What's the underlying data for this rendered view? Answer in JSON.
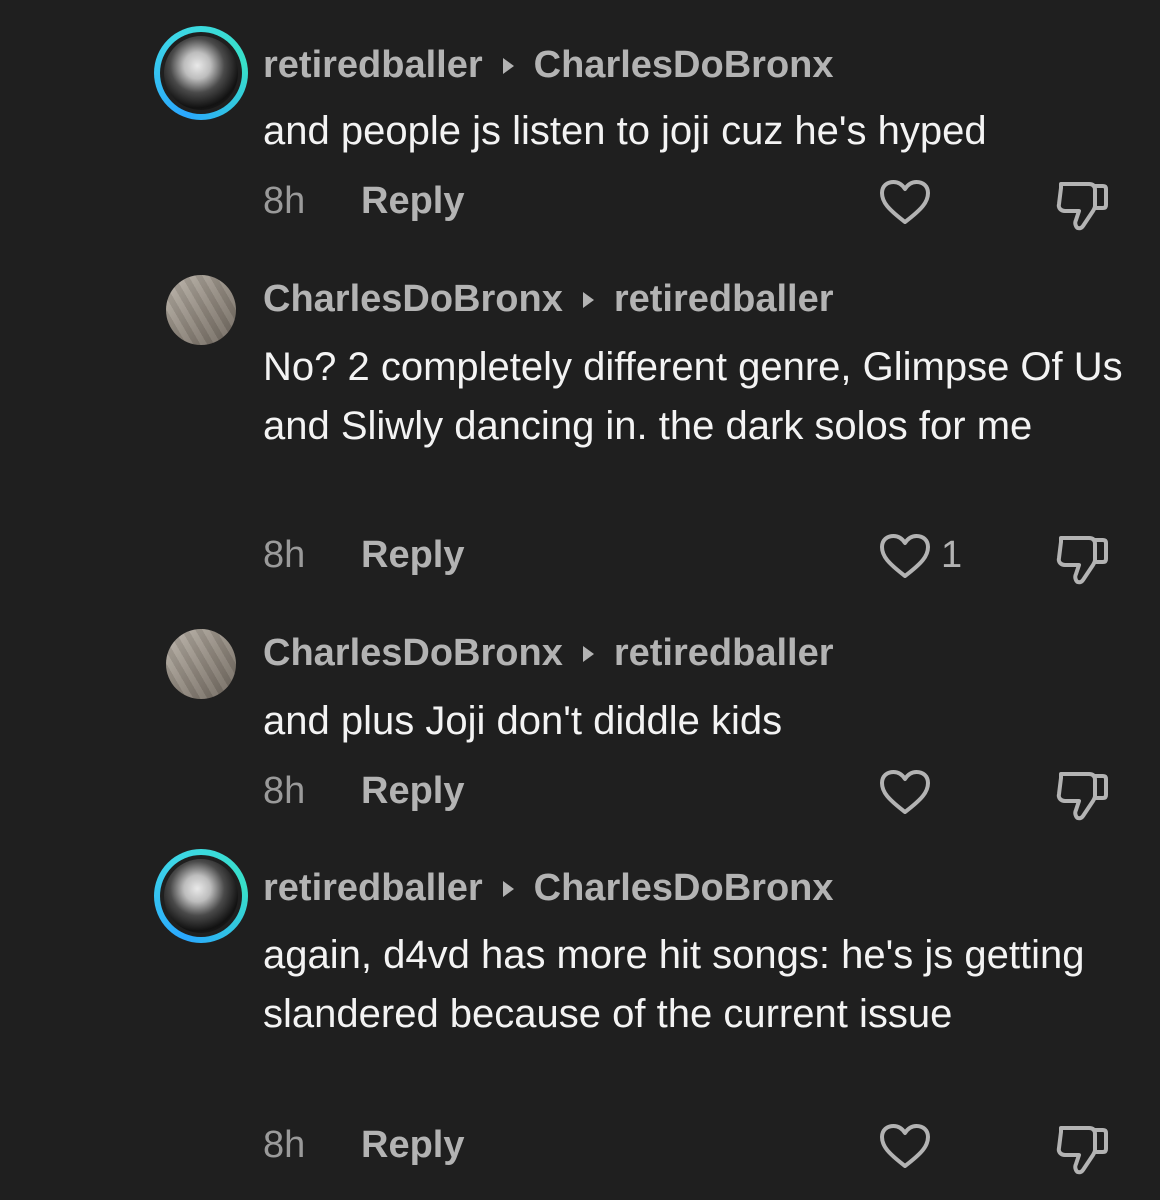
{
  "comments": [
    {
      "author": "retiredballer",
      "reply_to": "CharlesDoBronx",
      "text": "and people js listen to joji cuz he's hyped",
      "time": "8h",
      "reply_label": "Reply",
      "likes": ""
    },
    {
      "author": "CharlesDoBronx",
      "reply_to": "retiredballer",
      "text": "No? 2 completely different genre, Glimpse Of Us and Sliwly dancing in. the dark solos for me",
      "time": "8h",
      "reply_label": "Reply",
      "likes": "1"
    },
    {
      "author": "CharlesDoBronx",
      "reply_to": "retiredballer",
      "text": "and plus Joji don't diddle kids",
      "time": "8h",
      "reply_label": "Reply",
      "likes": ""
    },
    {
      "author": "retiredballer",
      "reply_to": "CharlesDoBronx",
      "text": "again, d4vd has more hit songs: he's js getting slandered because of the current issue",
      "time": "8h",
      "reply_label": "Reply",
      "likes": ""
    }
  ],
  "icons": {
    "like": "heart-outline-icon",
    "dislike": "thumbs-down-outline-icon",
    "reply_arrow": "caret-right-icon"
  },
  "colors": {
    "background": "#1f1f1f",
    "avatar_ring": "#2aa7ff",
    "username": "#b3b3b3",
    "body_text": "#f3f3f3"
  }
}
